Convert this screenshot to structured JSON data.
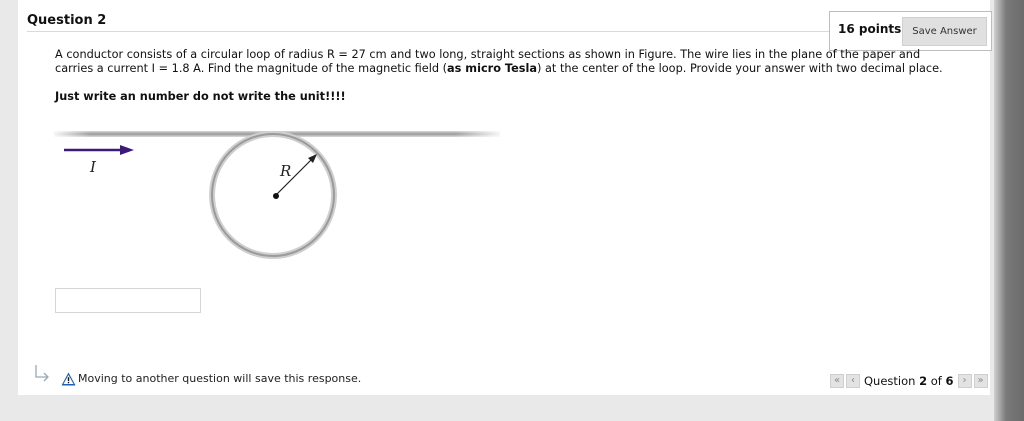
{
  "question": {
    "title": "Question 2",
    "points": "16 points",
    "save_label": "Save Answer",
    "text_part1": "A conductor consists of a circular loop of radius R = 27 cm and two long, straight sections as shown in Figure. The wire lies in the plane of the paper and carries a current I = 1.8 A. Find the magnitude of the magnetic field (",
    "text_bold": "as micro Tesla",
    "text_part2": ") at the center of the loop. Provide your answer with two decimal place.",
    "instruction": "Just write an number do not write the unit!!!!"
  },
  "figure": {
    "current_label": "I",
    "radius_label": "R"
  },
  "answer": {
    "value": ""
  },
  "footer": {
    "warning": "Moving to another question will save this response."
  },
  "nav": {
    "prefix": "Question",
    "current": "2",
    "of": "of",
    "total": "6",
    "first_icon": "«",
    "prev_icon": "‹",
    "next_icon": "›",
    "last_icon": "»"
  },
  "colors": {
    "arrow": "#3b1a78",
    "wire": "#b5b5b5"
  }
}
